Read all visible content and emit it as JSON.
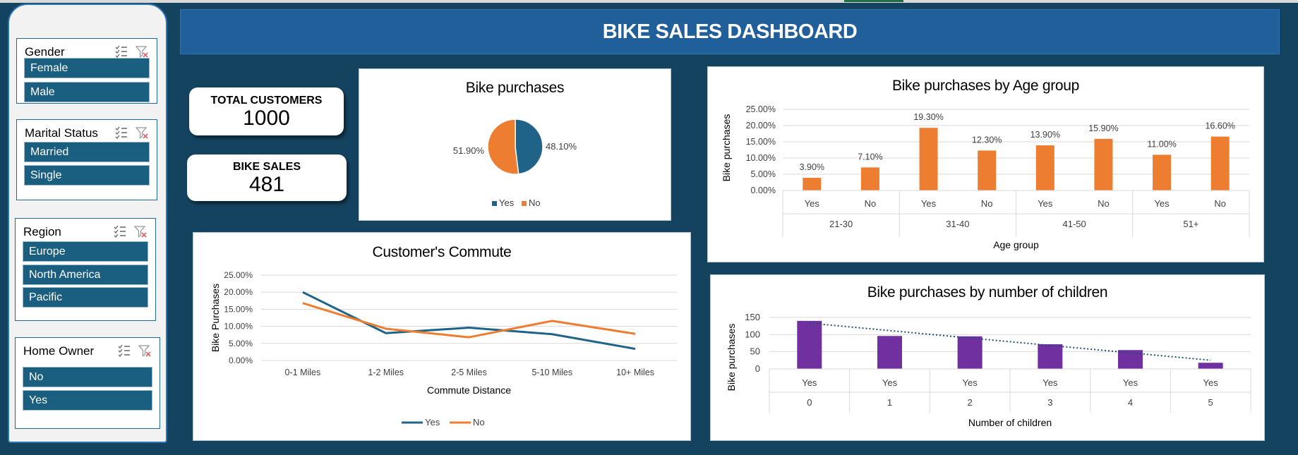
{
  "header": {
    "title": "BIKE SALES DASHBOARD"
  },
  "colors": {
    "yes": "#1f6388",
    "no": "#ed7d31",
    "age_bars": "#ed7d31",
    "children_bars": "#7030a0",
    "header_bg": "#215f9a",
    "background": "#14435f",
    "slicer_item": "#1a5e80"
  },
  "slicers": [
    {
      "title": "Gender",
      "items": [
        "Female",
        "Male"
      ]
    },
    {
      "title": "Marital Status",
      "items": [
        "Married",
        "Single"
      ]
    },
    {
      "title": "Region",
      "items": [
        "Europe",
        "North America",
        "Pacific"
      ]
    },
    {
      "title": "Home Owner",
      "items": [
        "No",
        "Yes"
      ]
    }
  ],
  "kpis": {
    "total_customers": {
      "label": "TOTAL CUSTOMERS",
      "value": "1000"
    },
    "bike_sales": {
      "label": "BIKE SALES",
      "value": "481"
    }
  },
  "chart_data": [
    {
      "id": "pie",
      "type": "pie",
      "title": "Bike purchases",
      "labels": [
        "Yes",
        "No"
      ],
      "values": [
        48.1,
        51.9
      ],
      "value_labels": [
        "48.10%",
        "51.90%"
      ],
      "legend": [
        "Yes",
        "No"
      ],
      "legend_position": "bottom"
    },
    {
      "id": "commute",
      "type": "line",
      "title": "Customer's Commute",
      "xlabel": "Commute Distance",
      "ylabel": "Bike Purchases",
      "categories": [
        "0-1 Miles",
        "1-2 Miles",
        "2-5 Miles",
        "5-10 Miles",
        "10+ Miles"
      ],
      "series": [
        {
          "name": "Yes",
          "values": [
            20.0,
            8.0,
            9.6,
            7.7,
            3.4
          ]
        },
        {
          "name": "No",
          "values": [
            16.8,
            9.3,
            6.8,
            11.6,
            7.8
          ]
        }
      ],
      "y_ticks": [
        "25.00%",
        "20.00%",
        "15.00%",
        "10.00%",
        "5.00%",
        "0.00%"
      ],
      "ylim": [
        0,
        25
      ],
      "grid": true,
      "legend_position": "bottom"
    },
    {
      "id": "age",
      "type": "bar",
      "title": "Bike purchases by Age group",
      "xlabel": "Age group",
      "ylabel": "Bike purchases",
      "groups": [
        "21-30",
        "31-40",
        "41-50",
        "51+"
      ],
      "categories": [
        "Yes",
        "No",
        "Yes",
        "No",
        "Yes",
        "No",
        "Yes",
        "No"
      ],
      "values": [
        3.9,
        7.1,
        19.3,
        12.3,
        13.9,
        15.9,
        11.0,
        16.6
      ],
      "value_labels": [
        "3.90%",
        "7.10%",
        "19.30%",
        "12.30%",
        "13.90%",
        "15.90%",
        "11.00%",
        "16.60%"
      ],
      "y_ticks": [
        "25.00%",
        "20.00%",
        "15.00%",
        "10.00%",
        "5.00%",
        "0.00%"
      ],
      "ylim": [
        0,
        25
      ],
      "grid": true
    },
    {
      "id": "children",
      "type": "bar",
      "title": "Bike purchases by  number of children",
      "xlabel": "Number of children",
      "ylabel": "Bike purchases",
      "groups": [
        "0",
        "1",
        "2",
        "3",
        "4",
        "5"
      ],
      "categories": [
        "Yes",
        "Yes",
        "Yes",
        "Yes",
        "Yes",
        "Yes"
      ],
      "values": [
        140,
        96,
        95,
        72,
        55,
        18
      ],
      "trendline": "linear",
      "y_ticks": [
        "150",
        "100",
        "50",
        "0"
      ],
      "ylim": [
        0,
        150
      ],
      "grid": true
    }
  ]
}
